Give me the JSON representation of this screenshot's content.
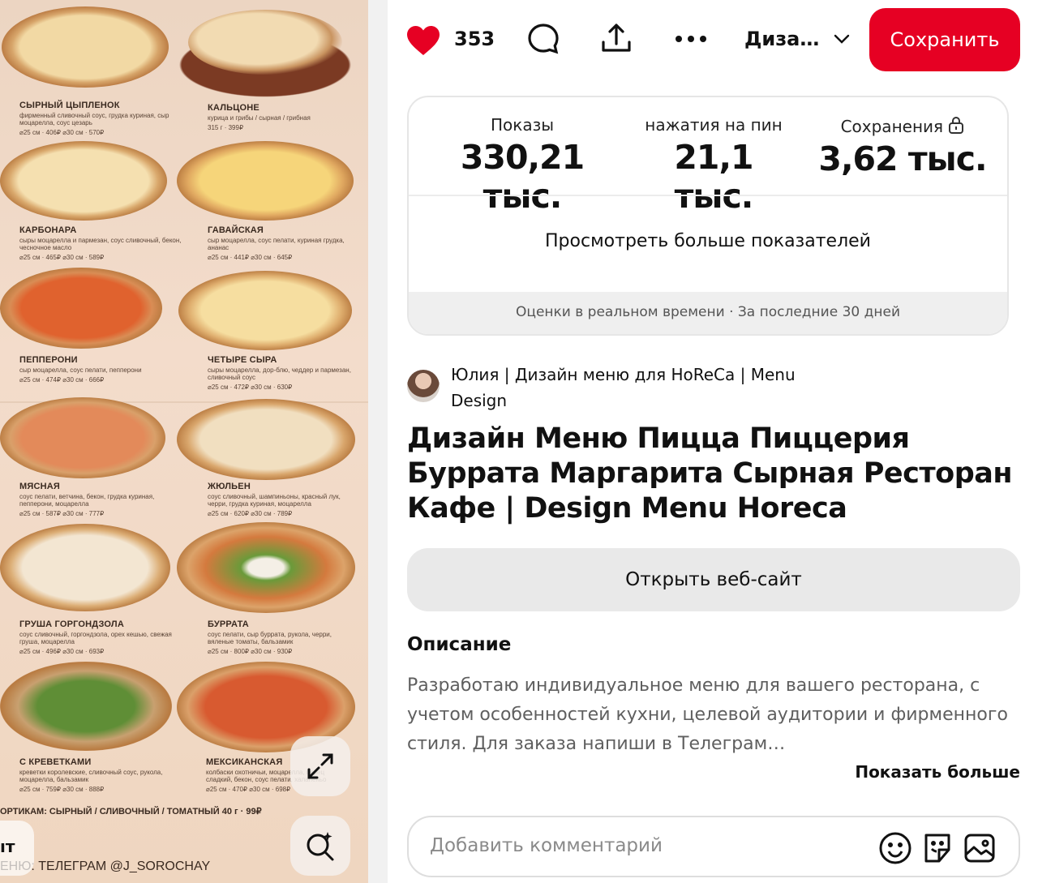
{
  "menu": {
    "pizzas": [
      {
        "name": "СЫРНЫЙ ЦЫПЛЕНОК",
        "desc": "фирменный сливочный соус, грудка куриная, сыр моцарелла, соус цезарь",
        "price": "⌀25 см · 406₽  ⌀30 см · 570₽"
      },
      {
        "name": "КАЛЬЦОНЕ",
        "desc": "курица и грибы / сырная / грибная",
        "price": "315 г · 399₽"
      },
      {
        "name": "КАРБОНАРА",
        "desc": "сыры моцарелла и пармезан, соус сливочный, бекон, чесночное масло",
        "price": "⌀25 см · 465₽  ⌀30 см · 589₽"
      },
      {
        "name": "ГАВАЙСКАЯ",
        "desc": "сыр моцарелла, соус пелати, куриная грудка, ананас",
        "price": "⌀25 см · 441₽  ⌀30 см · 645₽"
      },
      {
        "name": "ПЕППЕРОНИ",
        "desc": "сыр моцарелла, соус пелати, пепперони",
        "price": "⌀25 см · 474₽  ⌀30 см · 666₽"
      },
      {
        "name": "ЧЕТЫРЕ СЫРА",
        "desc": "сыры моцарелла, дор-блю, чеддер и пармезан, сливочный соус",
        "price": "⌀25 см · 472₽  ⌀30 см · 630₽"
      },
      {
        "name": "МЯСНАЯ",
        "desc": "соус пелати, ветчина, бекон, грудка куриная, пепперони, моцарелла",
        "price": "⌀25 см · 587₽  ⌀30 см · 777₽"
      },
      {
        "name": "ЖЮЛЬЕН",
        "desc": "соус сливочный, шампиньоны, красный лук, черри, грудка куриная, моцарелла",
        "price": "⌀25 см · 620₽  ⌀30 см · 789₽"
      },
      {
        "name": "ГРУША ГОРГОНДЗОЛА",
        "desc": "соус сливочный, горгондзола, орех кешью, свежая груша, моцарелла",
        "price": "⌀25 см · 496₽  ⌀30 см · 693₽"
      },
      {
        "name": "БУРРАТА",
        "desc": "соус пелати, сыр буррата, рукола, черри, вяленые томаты, бальзамик",
        "price": "⌀25 см · 800₽  ⌀30 см · 930₽"
      },
      {
        "name": "С КРЕВЕТКАМИ",
        "desc": "креветки королевские, сливочный соус, рукола, моцарелла, бальзамик",
        "price": "⌀25 см · 759₽  ⌀30 см · 888₽"
      },
      {
        "name": "МЕКСИКАНСКАЯ",
        "desc": "колбаски охотничьи, моцарелла, перец сладкий, бекон, соус пелати, халапеньо",
        "price": "⌀25 см · 470₽  ⌀30 см · 698₽"
      }
    ],
    "footer_line": "ОРТИКАМ: СЫРНЫЙ / СЛИВОЧНЫЙ / ТОМАТНЫЙ   40 г · 99₽",
    "footer_contact": "ЕНЮ: ТЕЛЕГРАМ @J_SOROCHAY",
    "left_button_text": "ıт"
  },
  "topbar": {
    "likes": "353",
    "board": "Диза…",
    "save_label": "Сохранить"
  },
  "stats": {
    "impressions_label": "Показы",
    "impressions_value": "330,21 тыс.",
    "clicks_label": "нажатия на пин",
    "clicks_value": "21,1 тыс.",
    "saves_label": "Сохранения",
    "saves_value": "3,62 тыс.",
    "more_label": "Просмотреть больше показателей",
    "footer": "Оценки в реальном времени · За последние 30 дней"
  },
  "author": "Юлия | Дизайн меню для HoReCa | Menu Design",
  "title": "Дизайн Меню Пицца Пиццерия Буррата Маргарита Сырная Ресторан Кафе | Design Menu Horeca",
  "open_site": "Открыть веб-сайт",
  "description": {
    "heading": "Описание",
    "text": "Разработаю индивидуальное меню для вашего ресторана, с учетом особенностей кухни, целевой аудитории и фирменного стиля. Для заказа напиши в Телеграм…",
    "show_more": "Показать больше"
  },
  "comment": {
    "placeholder": "Добавить комментарий"
  },
  "colors": {
    "accent": "#e60023",
    "heart": "#e60023"
  }
}
